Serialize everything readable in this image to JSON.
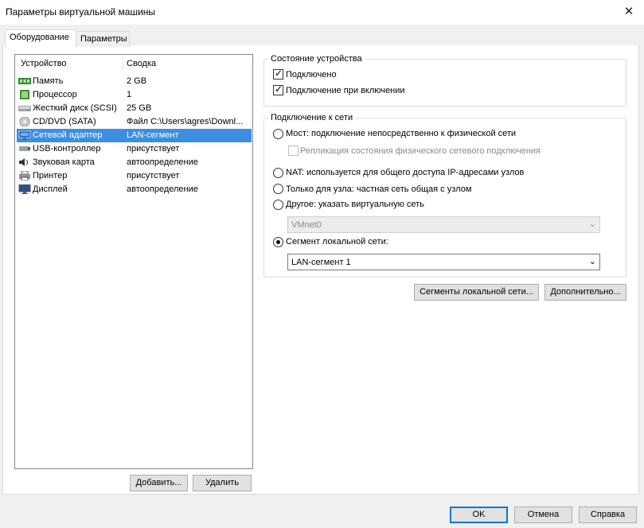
{
  "window": {
    "title": "Параметры виртуальной машины",
    "close_glyph": "✕"
  },
  "tabs": [
    {
      "label": "Оборудование"
    },
    {
      "label": "Параметры"
    }
  ],
  "device_list": {
    "col_device": "Устройство",
    "col_summary": "Сводка",
    "rows": [
      {
        "name": "Память",
        "summary": "2 GB",
        "icon": "memory-icon"
      },
      {
        "name": "Процессор",
        "summary": "1",
        "icon": "processor-icon"
      },
      {
        "name": "Жесткий диск (SCSI)",
        "summary": "25 GB",
        "icon": "hard-disk-icon"
      },
      {
        "name": "CD/DVD (SATA)",
        "summary": "Файл C:\\Users\\agres\\Downl...",
        "icon": "cd-dvd-icon"
      },
      {
        "name": "Сетевой адаптер",
        "summary": "LAN-сегмент",
        "icon": "network-adapter-icon"
      },
      {
        "name": "USB-контроллер",
        "summary": "присутствует",
        "icon": "usb-icon"
      },
      {
        "name": "Звуковая карта",
        "summary": "автоопределение",
        "icon": "sound-icon"
      },
      {
        "name": "Принтер",
        "summary": "присутствует",
        "icon": "printer-icon"
      },
      {
        "name": "Дисплей",
        "summary": "автоопределение",
        "icon": "display-icon"
      }
    ],
    "selected_index": 4
  },
  "left_buttons": {
    "add": "Добавить...",
    "remove": "Удалить"
  },
  "device_status": {
    "title": "Состояние устройства",
    "connected": "Подключено",
    "connect_on_power": "Подключение при включении"
  },
  "network": {
    "title": "Подключение к сети",
    "bridged": "Мост: подключение непосредственно к физической сети",
    "replicate": "Репликация состояния физического сетевого подключения",
    "nat": "NAT: используется для общего доступа IP-адресами узлов",
    "host_only": "Только для узла: частная сеть общая с узлом",
    "custom": "Другое: указать виртуальную сеть",
    "custom_value": "VMnet0",
    "lan_segment": "Сегмент локальной сети:",
    "lan_value": "LAN-сегмент 1",
    "selected": "lan_segment"
  },
  "right_buttons": {
    "lan_segments": "Сегменты локальной сети...",
    "advanced": "Дополнительно..."
  },
  "footer": {
    "ok": "OK",
    "cancel": "Отмена",
    "help": "Справка"
  },
  "colors": {
    "selection": "#3d8ee0",
    "default_button_border": "#0078d7"
  }
}
